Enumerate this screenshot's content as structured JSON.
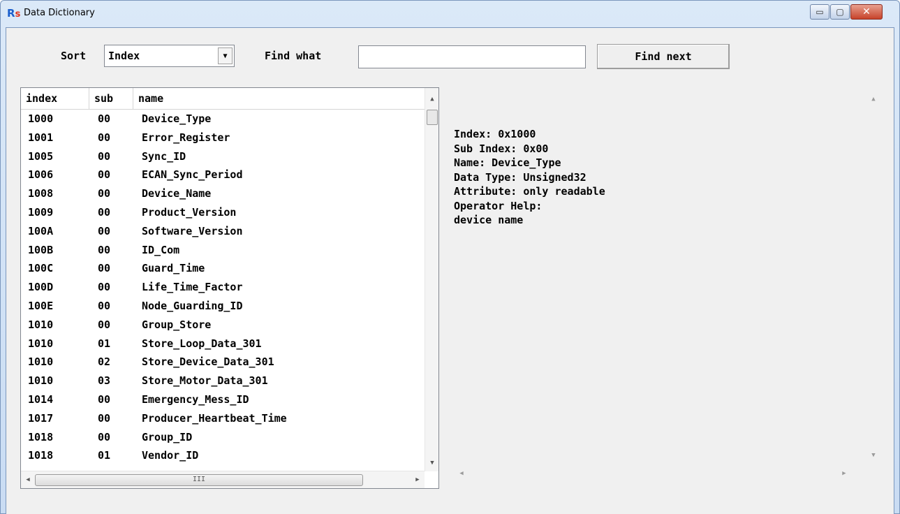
{
  "window": {
    "title": "Data Dictionary",
    "minimize_label": "▭",
    "maximize_label": "▢",
    "close_label": "✕"
  },
  "toolbar": {
    "sort_label": "Sort",
    "sort_value": "Index",
    "find_label": "Find what",
    "find_value": "",
    "find_next_label": "Find next"
  },
  "list": {
    "columns": [
      "index",
      "sub",
      "name"
    ],
    "rows": [
      {
        "index": "1000",
        "sub": "00",
        "name": "Device_Type"
      },
      {
        "index": "1001",
        "sub": "00",
        "name": "Error_Register"
      },
      {
        "index": "1005",
        "sub": "00",
        "name": "Sync_ID"
      },
      {
        "index": "1006",
        "sub": "00",
        "name": "ECAN_Sync_Period"
      },
      {
        "index": "1008",
        "sub": "00",
        "name": "Device_Name"
      },
      {
        "index": "1009",
        "sub": "00",
        "name": "Product_Version"
      },
      {
        "index": "100A",
        "sub": "00",
        "name": "Software_Version"
      },
      {
        "index": "100B",
        "sub": "00",
        "name": "ID_Com"
      },
      {
        "index": "100C",
        "sub": "00",
        "name": "Guard_Time"
      },
      {
        "index": "100D",
        "sub": "00",
        "name": "Life_Time_Factor"
      },
      {
        "index": "100E",
        "sub": "00",
        "name": "Node_Guarding_ID"
      },
      {
        "index": "1010",
        "sub": "00",
        "name": "Group_Store"
      },
      {
        "index": "1010",
        "sub": "01",
        "name": "Store_Loop_Data_301"
      },
      {
        "index": "1010",
        "sub": "02",
        "name": "Store_Device_Data_301"
      },
      {
        "index": "1010",
        "sub": "03",
        "name": "Store_Motor_Data_301"
      },
      {
        "index": "1014",
        "sub": "00",
        "name": "Emergency_Mess_ID"
      },
      {
        "index": "1017",
        "sub": "00",
        "name": "Producer_Heartbeat_Time"
      },
      {
        "index": "1018",
        "sub": "00",
        "name": "Group_ID"
      },
      {
        "index": "1018",
        "sub": "01",
        "name": "Vendor_ID"
      }
    ]
  },
  "detail": {
    "lines": [
      "Index: 0x1000",
      "Sub Index: 0x00",
      "Name: Device_Type",
      "Data Type: Unsigned32",
      "Attribute: only readable",
      "Operator Help:",
      "device name"
    ]
  },
  "icons": {
    "dropdown": "chevron-down-icon",
    "scroll_up": "scroll-up-icon",
    "scroll_down": "scroll-down-icon",
    "scroll_left": "scroll-left-icon",
    "scroll_right": "scroll-right-icon"
  },
  "colors": {
    "titlebar": "#c9dcf3",
    "close_button": "#c7432b",
    "panel_bg": "#f0f0f0"
  }
}
